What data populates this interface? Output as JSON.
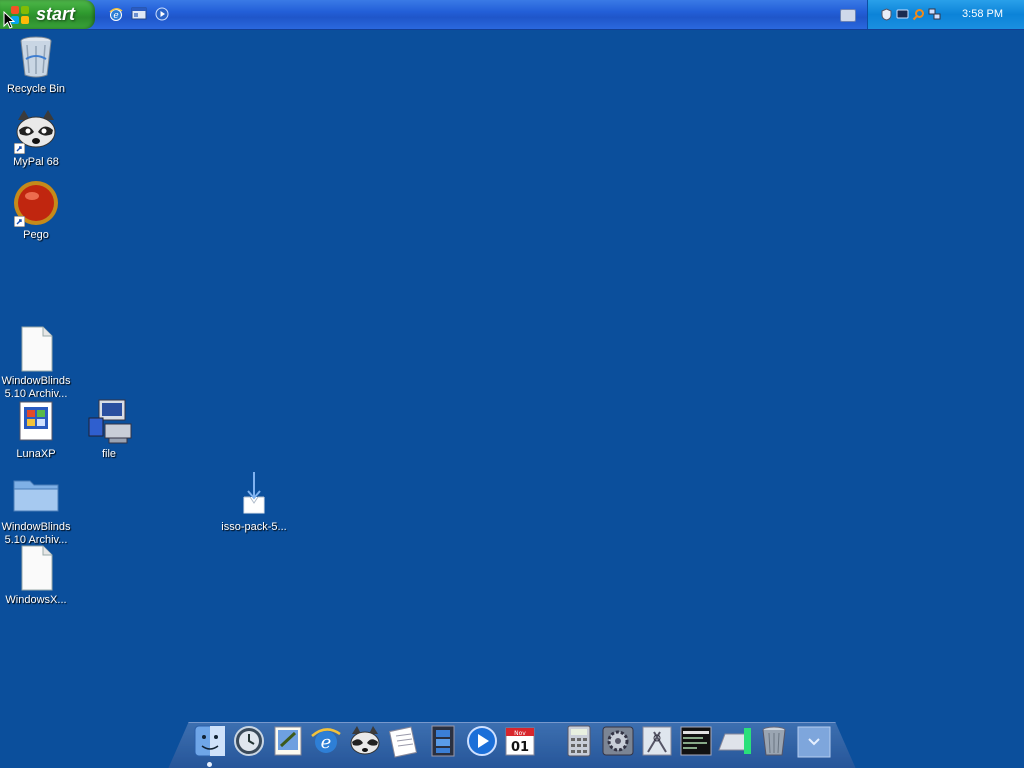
{
  "taskbar": {
    "start_label": "start",
    "quick_launch": [
      "internet-explorer-icon",
      "show-desktop-icon",
      "media-player-icon"
    ],
    "clock": "3:58 PM"
  },
  "desktop_icons": [
    {
      "label": "Recycle Bin",
      "icon": "recycle-bin-icon"
    },
    {
      "label": "MyPal 68",
      "icon": "mypal-icon"
    },
    {
      "label": "Pego",
      "icon": "pego-icon"
    },
    {
      "label": "WindowBlinds 5.10 Archiv...",
      "icon": "file-icon"
    },
    {
      "label": "LunaXP",
      "icon": "lunaxp-icon"
    },
    {
      "label": "file",
      "icon": "setup-icon"
    },
    {
      "label": "isso-pack-5...",
      "icon": "download-icon"
    },
    {
      "label": "WindowBlinds 5.10 Archiv...",
      "icon": "folder-icon"
    },
    {
      "label": "WindowsX...",
      "icon": "file-icon"
    }
  ],
  "dock_items": [
    "finder-icon",
    "time-machine-icon",
    "mail-icon",
    "internet-explorer-icon",
    "mypal-icon",
    "text-edit-icon",
    "video-icon",
    "quicktime-icon",
    "calendar-icon",
    "calculator-icon",
    "system-preferences-icon",
    "utilities-icon",
    "console-icon",
    "drive-icon",
    "trash-icon",
    "stack-icon"
  ],
  "calendar": {
    "month": "Nov",
    "day": "01"
  },
  "colors": {
    "desktop": "#0b4f9c",
    "taskbar": "#235fd8",
    "start": "#2f9a2f",
    "tray": "#0c83d8"
  }
}
